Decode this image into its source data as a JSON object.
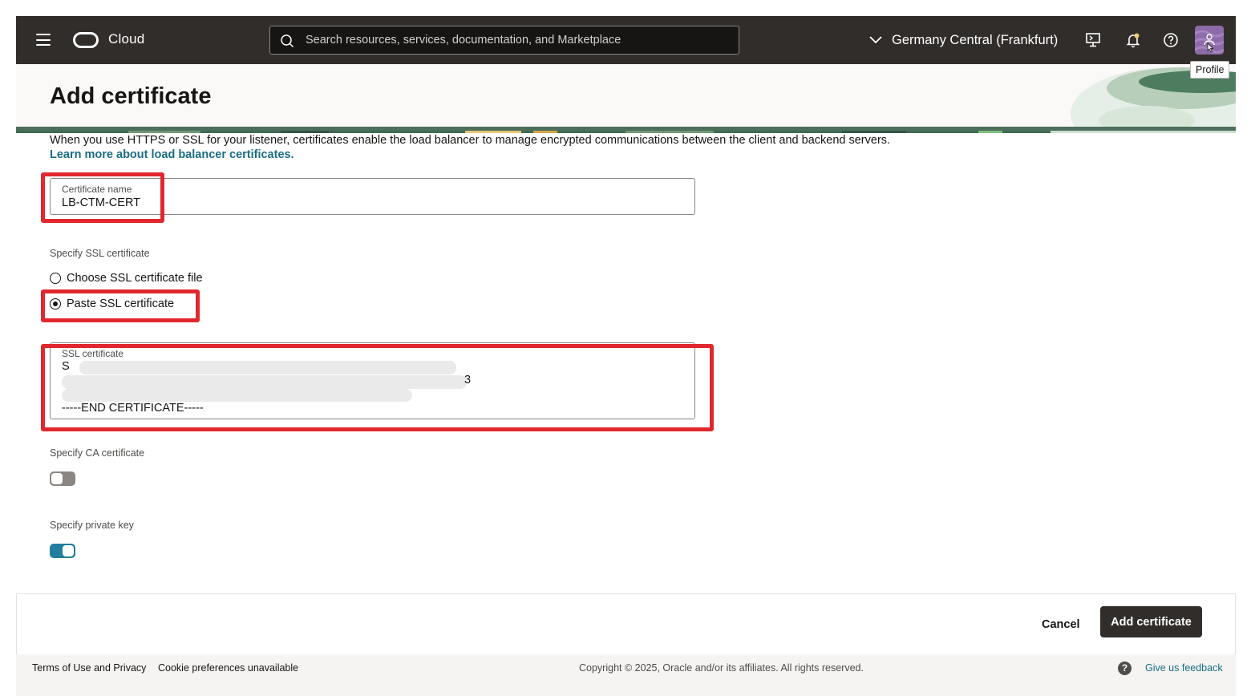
{
  "topbar": {
    "brand": "Cloud",
    "search_placeholder": "Search resources, services, documentation, and Marketplace",
    "region": "Germany Central (Frankfurt)",
    "profile_tooltip": "Profile"
  },
  "page": {
    "title": "Add certificate",
    "description": "When you use HTTPS or SSL for your listener, certificates enable the load balancer to manage encrypted communications between the client and backend servers.",
    "learn_more": "Learn more about load balancer certificates."
  },
  "form": {
    "cert_name": {
      "label": "Certificate name",
      "value": "LB-CTM-CERT"
    },
    "ssl_section_label": "Specify SSL certificate",
    "ssl_options": [
      {
        "label": "Choose SSL certificate file",
        "selected": false
      },
      {
        "label": "Paste SSL certificate",
        "selected": true
      }
    ],
    "ssl_cert": {
      "label": "SSL certificate",
      "line1": "S",
      "line2_end": "3",
      "last_line": "-----END CERTIFICATE-----"
    },
    "ca_label": "Specify CA certificate",
    "ca_enabled": false,
    "private_key_label": "Specify private key",
    "private_key_enabled": true
  },
  "actions": {
    "cancel": "Cancel",
    "submit": "Add certificate"
  },
  "footer": {
    "terms": "Terms of Use and Privacy",
    "cookies": "Cookie preferences unavailable",
    "copyright": "Copyright © 2025, Oracle and/or its affiliates. All rights reserved.",
    "help_glyph": "?",
    "feedback": "Give us feedback"
  },
  "colors": {
    "nav_bg": "#312d2a",
    "link": "#1a6d84",
    "highlight": "#e0282e",
    "toggle_on": "#227e9e",
    "primary_button": "#312d2a"
  }
}
